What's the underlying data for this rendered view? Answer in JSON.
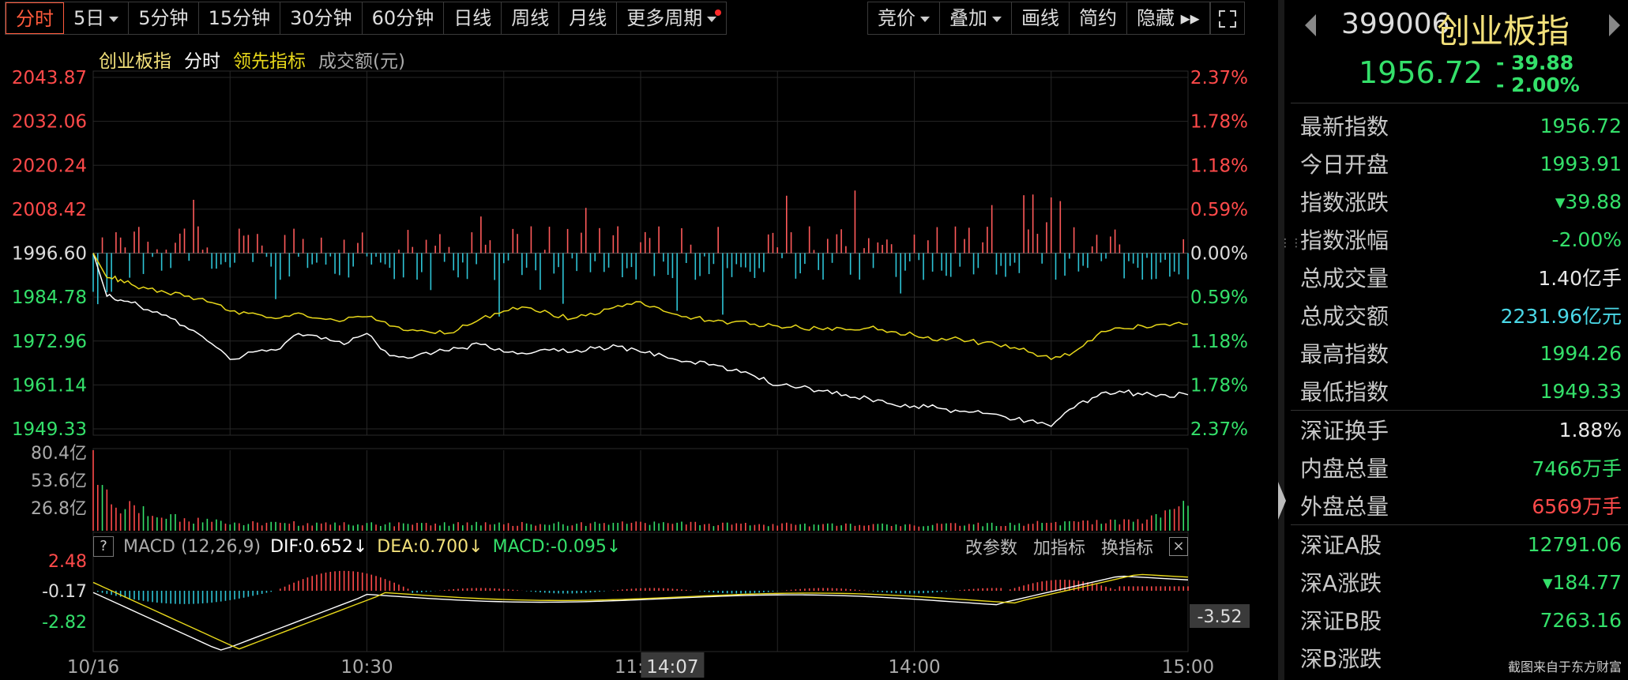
{
  "toolbar": {
    "tabs": [
      {
        "label": "分时",
        "active": true
      },
      {
        "label": "5日",
        "caret": true
      },
      {
        "label": "5分钟"
      },
      {
        "label": "15分钟"
      },
      {
        "label": "30分钟"
      },
      {
        "label": "60分钟"
      },
      {
        "label": "日线"
      },
      {
        "label": "周线"
      },
      {
        "label": "月线"
      },
      {
        "label": "更多周期",
        "caret": true,
        "dot": true
      }
    ],
    "right": [
      {
        "label": "竞价",
        "caret": true
      },
      {
        "label": "叠加",
        "caret": true
      },
      {
        "label": "画线"
      },
      {
        "label": "简约"
      },
      {
        "label": "隐藏 ▸▸"
      }
    ]
  },
  "legend": {
    "index": "创业板指",
    "fenshi": "分时",
    "lead": "领先指标",
    "amount": "成交额(元)"
  },
  "price_axis": {
    "left": [
      "2043.87",
      "2032.06",
      "2020.24",
      "2008.42",
      "1996.60",
      "1984.78",
      "1972.96",
      "1961.14",
      "1949.33"
    ],
    "right": [
      "2.37%",
      "1.78%",
      "1.18%",
      "0.59%",
      "0.00%",
      "0.59%",
      "1.18%",
      "1.78%",
      "2.37%"
    ]
  },
  "volume_axis": [
    "80.4亿",
    "53.6亿",
    "26.8亿"
  ],
  "macd": {
    "help": "?",
    "title": "MACD (12,26,9)",
    "dif": "DIF:0.652↓",
    "dea": "DEA:0.700↓",
    "macd": "MACD:-0.095↓",
    "actions": [
      "改参数",
      "加指标",
      "换指标"
    ],
    "close": "×",
    "axis": [
      "2.48",
      "-0.17",
      "-2.82"
    ],
    "cursor_value": "-3.52"
  },
  "time_axis": {
    "labels": [
      "10/16",
      "10:30",
      "11:30",
      "14:00",
      "15:00"
    ],
    "cursor": "14:07"
  },
  "chart_data": {
    "type": "line",
    "title": "",
    "prev_close": 1996.6,
    "ylim": [
      1949.33,
      2043.87
    ],
    "x_range": [
      0,
      240
    ],
    "series": [
      {
        "name": "创业板指",
        "color": "#ffffff",
        "x": [
          0,
          3,
          6,
          10,
          15,
          20,
          25,
          30,
          35,
          40,
          45,
          50,
          55,
          60,
          65,
          70,
          75,
          80,
          85,
          90,
          95,
          100,
          105,
          110,
          115,
          120,
          125,
          130,
          135,
          140,
          145,
          150,
          155,
          160,
          165,
          170,
          175,
          180,
          185,
          190,
          195,
          200,
          205,
          210,
          215,
          220,
          225,
          230,
          235,
          240
        ],
        "values": [
          1996.6,
          1985.0,
          1984.0,
          1982.5,
          1980.0,
          1977.0,
          1973.0,
          1968.0,
          1970.0,
          1970.5,
          1975.0,
          1973.5,
          1972.0,
          1975.0,
          1969.0,
          1968.5,
          1970.0,
          1971.0,
          1972.0,
          1970.0,
          1969.5,
          1970.5,
          1970.0,
          1971.0,
          1971.5,
          1970.0,
          1969.0,
          1967.5,
          1966.5,
          1965.0,
          1963.5,
          1961.0,
          1960.5,
          1959.5,
          1958.5,
          1957.5,
          1956.0,
          1955.5,
          1955.0,
          1954.0,
          1953.5,
          1952.5,
          1951.5,
          1950.0,
          1955.0,
          1958.0,
          1959.5,
          1958.5,
          1958.5,
          1958.5
        ]
      },
      {
        "name": "领先指标",
        "color": "#e8d81a",
        "x": [
          0,
          3,
          6,
          10,
          15,
          20,
          25,
          30,
          35,
          40,
          45,
          50,
          55,
          60,
          65,
          70,
          75,
          80,
          85,
          90,
          95,
          100,
          105,
          110,
          115,
          120,
          125,
          130,
          135,
          140,
          145,
          150,
          155,
          160,
          165,
          170,
          175,
          180,
          185,
          190,
          195,
          200,
          205,
          210,
          215,
          220,
          225,
          230,
          235,
          240
        ],
        "values": [
          1996.6,
          1990.0,
          1989.5,
          1987.0,
          1986.5,
          1985.0,
          1983.5,
          1981.0,
          1980.5,
          1979.0,
          1980.5,
          1979.0,
          1978.5,
          1979.5,
          1977.0,
          1976.0,
          1975.0,
          1976.0,
          1979.0,
          1981.0,
          1982.0,
          1980.5,
          1979.0,
          1980.0,
          1982.5,
          1983.5,
          1981.0,
          1979.5,
          1978.5,
          1978.0,
          1977.5,
          1977.0,
          1976.5,
          1976.0,
          1976.0,
          1976.5,
          1975.5,
          1974.5,
          1973.0,
          1973.5,
          1972.5,
          1972.0,
          1970.0,
          1968.0,
          1970.0,
          1974.5,
          1976.5,
          1977.0,
          1977.5,
          1977.5
        ]
      }
    ],
    "volume_peaks": [
      {
        "x": 0,
        "value": 80.4
      },
      {
        "x": 2,
        "value": 40
      },
      {
        "x": 5,
        "value": 30
      },
      {
        "x": 10,
        "value": 22
      },
      {
        "x": 20,
        "value": 12
      },
      {
        "x": 30,
        "value": 9
      },
      {
        "x": 60,
        "value": 7
      },
      {
        "x": 120,
        "value": 8
      },
      {
        "x": 180,
        "value": 6
      },
      {
        "x": 230,
        "value": 10
      },
      {
        "x": 239,
        "value": 26
      }
    ]
  },
  "header": {
    "code": "399006",
    "name": "创业板指",
    "price": "1956.72",
    "change": "- 39.88",
    "pct": "- 2.00%"
  },
  "stats": [
    {
      "k": "最新指数",
      "v": "1956.72",
      "cls": "g"
    },
    {
      "k": "今日开盘",
      "v": "1993.91",
      "cls": "g"
    },
    {
      "k": "指数涨跌",
      "v": "▾39.88",
      "cls": "g"
    },
    {
      "k": "指数涨幅",
      "v": "-2.00%",
      "cls": "g"
    },
    {
      "k": "总成交量",
      "v": "1.40亿手",
      "cls": "w"
    },
    {
      "k": "总成交额",
      "v": "2231.96亿元",
      "cls": "c"
    },
    {
      "k": "最高指数",
      "v": "1994.26",
      "cls": "g"
    },
    {
      "k": "最低指数",
      "v": "1949.33",
      "cls": "g"
    }
  ],
  "stats2": [
    {
      "k": "深证换手",
      "v": "1.88%",
      "cls": "w"
    },
    {
      "k": "内盘总量",
      "v": "7466万手",
      "cls": "g"
    },
    {
      "k": "外盘总量",
      "v": "6569万手",
      "cls": "r"
    }
  ],
  "stats3": [
    {
      "k": "深证A股",
      "v": "12791.06",
      "cls": "g"
    },
    {
      "k": "深A涨跌",
      "v": "▾184.77",
      "cls": "g"
    },
    {
      "k": "深证B股",
      "v": "7263.16",
      "cls": "g"
    },
    {
      "k": "深B涨跌",
      "v": "",
      "cls": "g"
    }
  ],
  "watermark": "截图来自于东方财富"
}
